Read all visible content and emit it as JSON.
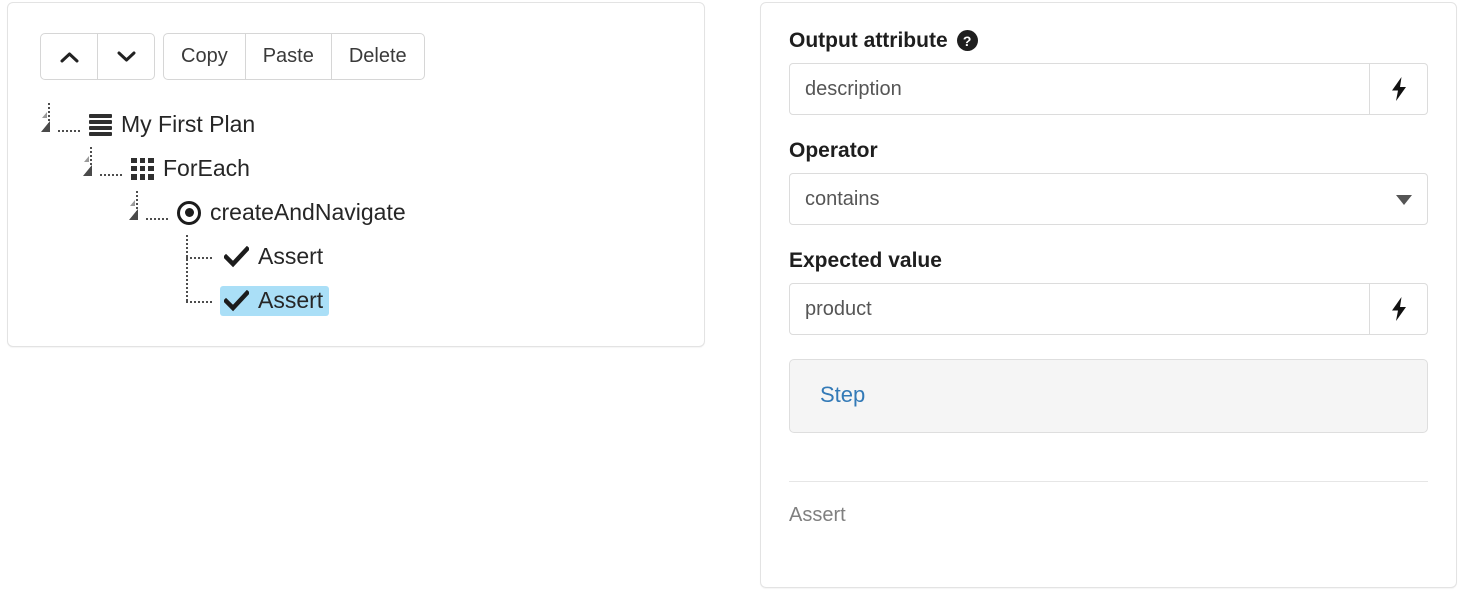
{
  "toolbar": {
    "move_up_label": "",
    "move_up_icon": "chevron-up-icon",
    "move_down_label": "",
    "move_down_icon": "chevron-down-icon",
    "copy_label": "Copy",
    "paste_label": "Paste",
    "delete_label": "Delete"
  },
  "tree": {
    "nodes": [
      {
        "label": "My First Plan",
        "icon": "hamburger-icon",
        "depth": 0,
        "selected": false,
        "expanded": true
      },
      {
        "label": "ForEach",
        "icon": "grid-icon",
        "depth": 1,
        "selected": false,
        "expanded": true
      },
      {
        "label": "createAndNavigate",
        "icon": "bullseye-icon",
        "depth": 2,
        "selected": false,
        "expanded": true
      },
      {
        "label": "Assert",
        "icon": "check-icon",
        "depth": 3,
        "selected": false,
        "expanded": false
      },
      {
        "label": "Assert",
        "icon": "check-icon",
        "depth": 3,
        "selected": true,
        "expanded": false
      }
    ],
    "selection_color": "#aadff7"
  },
  "details": {
    "output_attribute": {
      "label": "Output attribute",
      "help_glyph": "?",
      "value": "description",
      "placeholder": "description",
      "bolt_icon": "lightning-bolt-icon"
    },
    "operator": {
      "label": "Operator",
      "value": "contains",
      "options": [
        "contains"
      ],
      "arrow_icon": "caret-down-icon"
    },
    "expected_value": {
      "label": "Expected value",
      "value": "product",
      "placeholder": "product",
      "bolt_icon": "lightning-bolt-icon"
    },
    "step_panel": {
      "link_label": "Step",
      "link_color": "#337ab7"
    },
    "footer_note": "Assert"
  }
}
